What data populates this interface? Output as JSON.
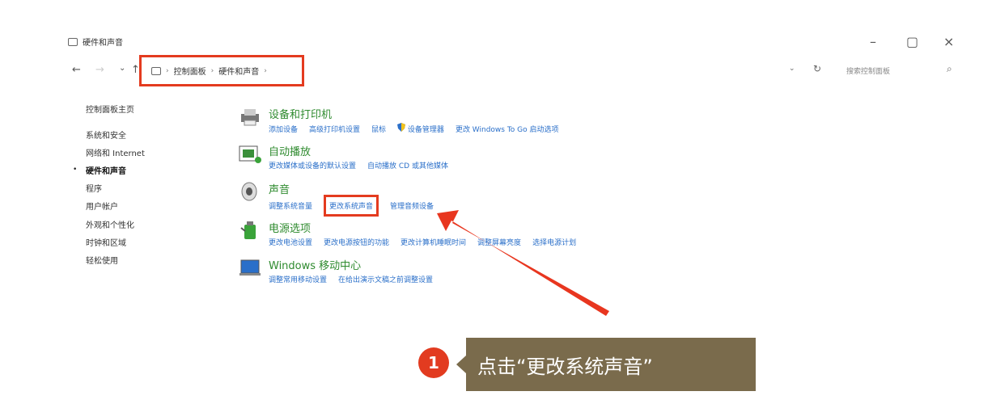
{
  "window": {
    "title": "硬件和声音",
    "minimize_icon": "–",
    "maximize_icon": "▢",
    "close_icon": "×"
  },
  "nav": {
    "back_icon": "←",
    "forward_icon": "→",
    "down_icon": "⌄",
    "up_icon": "↑",
    "breadcrumb": [
      "控制面板",
      "硬件和声音"
    ],
    "separator": "›",
    "refresh_icon": "↻",
    "search_placeholder": "搜索控制面板",
    "search_icon": "⌕"
  },
  "sidebar": {
    "items": [
      {
        "label": "控制面板主页"
      },
      {
        "label": "系统和安全"
      },
      {
        "label": "网络和 Internet"
      },
      {
        "label": "硬件和声音"
      },
      {
        "label": "程序"
      },
      {
        "label": "用户帐户"
      },
      {
        "label": "外观和个性化"
      },
      {
        "label": "时钟和区域"
      },
      {
        "label": "轻松使用"
      }
    ],
    "active_marker": "•"
  },
  "categories": [
    {
      "title": "设备和打印机",
      "icon": "printer-icon",
      "links": [
        "添加设备",
        "高级打印机设置",
        "鼠标",
        "设备管理器",
        "更改 Windows To Go 启动选项"
      ]
    },
    {
      "title": "自动播放",
      "icon": "autoplay-icon",
      "links": [
        "更改媒体或设备的默认设置",
        "自动播放 CD 或其他媒体"
      ]
    },
    {
      "title": "声音",
      "icon": "speaker-icon",
      "links": [
        "调整系统音量",
        "更改系统声音",
        "管理音频设备"
      ]
    },
    {
      "title": "电源选项",
      "icon": "power-icon",
      "links": [
        "更改电池设置",
        "更改电源按钮的功能",
        "更改计算机睡眠时间",
        "调整屏幕亮度",
        "选择电源计划"
      ]
    },
    {
      "title": "Windows 移动中心",
      "icon": "mobility-center-icon",
      "links": [
        "调整常用移动设置",
        "在给出演示文稿之前调整设置"
      ]
    }
  ],
  "annotation": {
    "step_number": "1",
    "text": "点击“更改系统声音”",
    "highlight_color": "#e43b1f",
    "callout_color": "#7a6b4c"
  }
}
